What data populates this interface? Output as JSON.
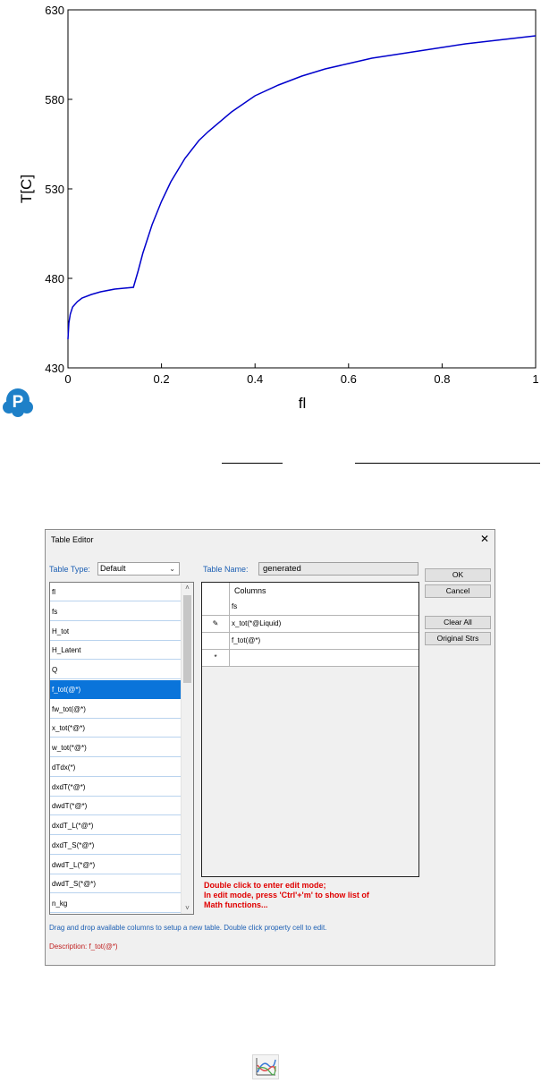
{
  "chart_data": {
    "type": "line",
    "xlabel": "fl",
    "ylabel": "T[C]",
    "xlim": [
      0,
      1
    ],
    "ylim": [
      430,
      630
    ],
    "xticks": [
      "0",
      "0.2",
      "0.4",
      "0.6",
      "0.8",
      "1"
    ],
    "yticks": [
      "430",
      "480",
      "530",
      "580",
      "630"
    ],
    "grid": false,
    "series": [
      {
        "color": "#0000cc",
        "x": [
          0,
          0.002,
          0.005,
          0.01,
          0.02,
          0.03,
          0.05,
          0.07,
          0.1,
          0.12,
          0.14,
          0.15,
          0.16,
          0.18,
          0.2,
          0.22,
          0.25,
          0.28,
          0.3,
          0.35,
          0.4,
          0.45,
          0.5,
          0.55,
          0.6,
          0.65,
          0.7,
          0.75,
          0.8,
          0.85,
          0.9,
          0.95,
          1.0
        ],
        "y": [
          446,
          455,
          460,
          464,
          467,
          469,
          471,
          472.5,
          474,
          474.5,
          475,
          484,
          494,
          510,
          523,
          534,
          547,
          557,
          562,
          573,
          582,
          588,
          593,
          597,
          600,
          603,
          605,
          607,
          609,
          611,
          612.5,
          614,
          615.5
        ]
      }
    ]
  },
  "logo_letter": "P",
  "dialog": {
    "title": "Table Editor",
    "close": "✕",
    "table_type_label": "Table Type:",
    "table_type_value": "Default",
    "table_name_label": "Table Name:",
    "table_name_value": "generated",
    "available_items": [
      "fl",
      "fs",
      "H_tot",
      "H_Latent",
      "Q",
      "f_tot(@*)",
      "fw_tot(@*)",
      "x_tot(*@*)",
      "w_tot(*@*)",
      "dTdx(*)",
      "dxdT(*@*)",
      "dwdT(*@*)",
      "dxdT_L(*@*)",
      "dxdT_S(*@*)",
      "dwdT_L(*@*)",
      "dwdT_S(*@*)",
      "n_kg"
    ],
    "selected_item": "f_tot(@*)",
    "columns_header": "Columns",
    "columns": [
      "fs",
      "x_tot(*@Liquid)",
      "f_tot(@*)"
    ],
    "new_row_marker": "*",
    "edit_marker": "✎",
    "buttons": {
      "ok": "OK",
      "cancel": "Cancel",
      "clear_all": "Clear All",
      "original_strs": "Original Strs"
    },
    "hint_lines": [
      "Double click to enter edit mode;",
      "In edit mode, press 'Ctrl'+'m' to show list of",
      "Math functions..."
    ],
    "help_text": "Drag and drop available columns to setup a new table. Double click property cell to edit.",
    "description": "Description: f_tot(@*)"
  },
  "colors": {
    "curve": "#0000cc",
    "selected": "#0a74da",
    "hint": "#e00000",
    "label_blue": "#1c5fb3",
    "logo": "#1e80c8"
  }
}
